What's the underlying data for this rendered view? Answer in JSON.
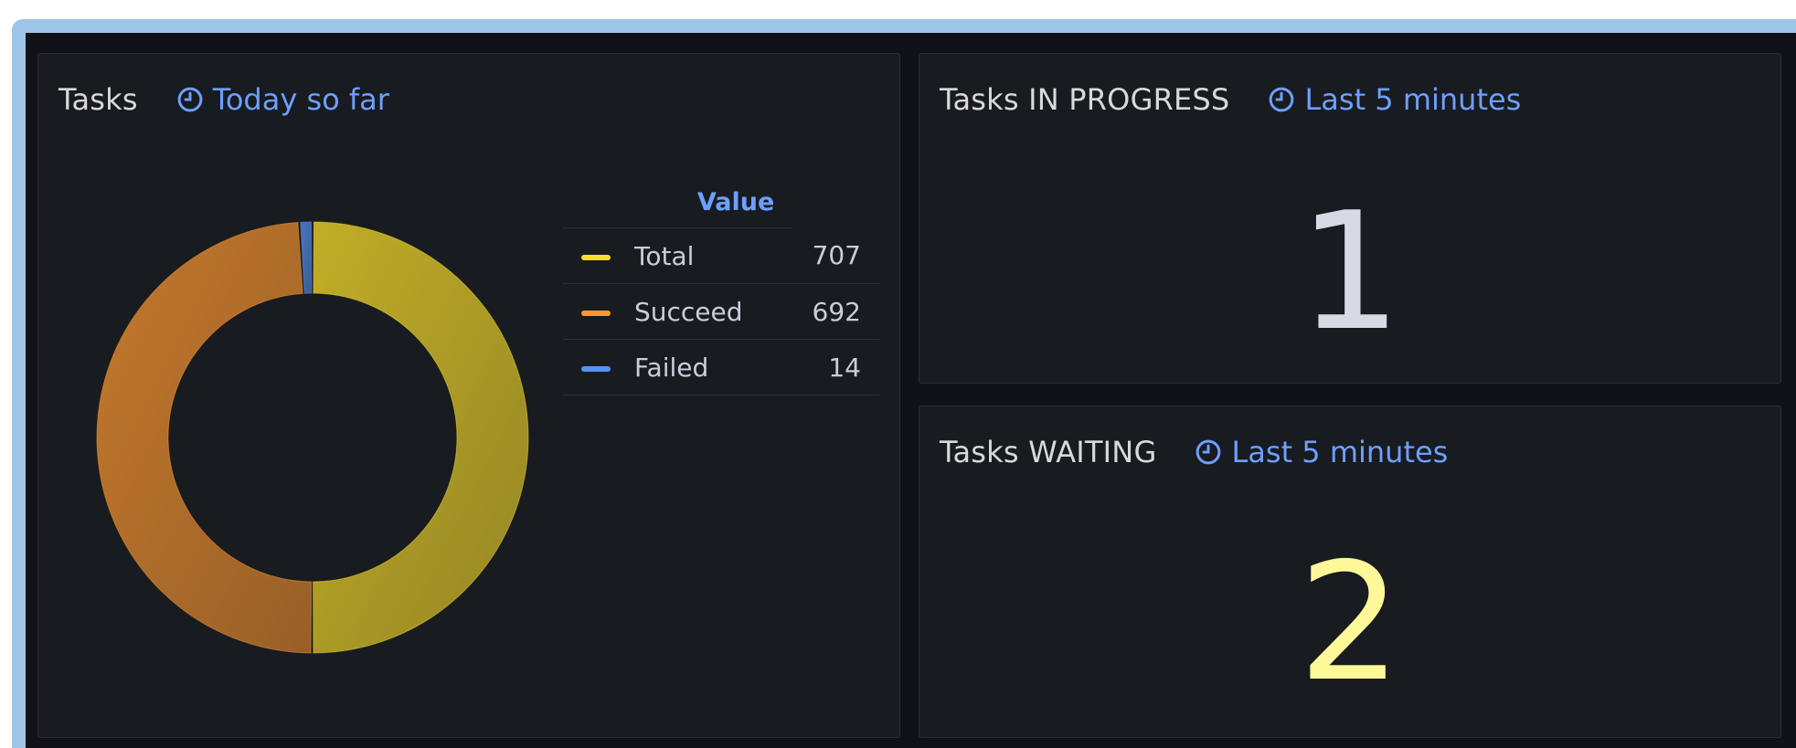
{
  "panels": {
    "tasks": {
      "title": "Tasks",
      "time_range": "Today so far",
      "legend_header": "Value"
    },
    "in_progress": {
      "title": "Tasks IN PROGRESS",
      "time_range": "Last 5 minutes",
      "value": "1",
      "value_color": "#d8d9e4"
    },
    "waiting": {
      "title": "Tasks WAITING",
      "time_range": "Last 5 minutes",
      "value": "2",
      "value_color": "#fff899"
    }
  },
  "chart_data": {
    "type": "pie",
    "donut": true,
    "legend_placement": "right",
    "labels": [
      "Total",
      "Succeed",
      "Failed"
    ],
    "values": [
      707,
      692,
      14
    ],
    "colors": [
      "#fade2a",
      "#ff9830",
      "#5794f2"
    ]
  },
  "colors": {
    "background": "#111217",
    "panel": "#181b1f",
    "accent_link": "#6e9fff",
    "frame": "#9fc5e8"
  },
  "icons": {
    "time": "clock-icon"
  }
}
